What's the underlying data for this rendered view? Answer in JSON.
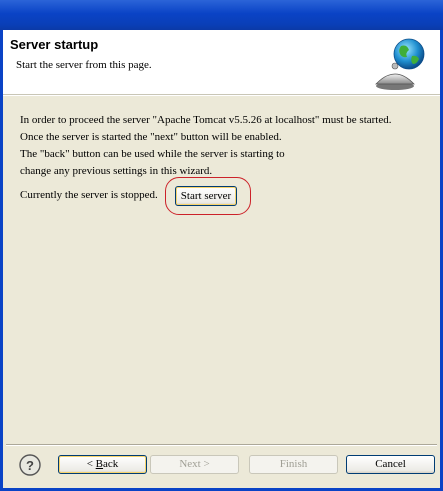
{
  "banner": {
    "title": "Server startup",
    "description": "Start the server from this page."
  },
  "message": {
    "lines": [
      "In order to proceed the server \"Apache Tomcat v5.5.26 at localhost\" must be started.",
      "Once the server is started the \"next\" button will be enabled.",
      "The \"back\" button can be used while the server is starting to",
      "change any previous settings in this wizard."
    ]
  },
  "status": {
    "text": "Currently the server is stopped.",
    "start_button_label": "Start server"
  },
  "buttons": {
    "help_symbol": "?",
    "back_prefix": "< ",
    "back_mnemonic": "B",
    "back_rest": "ack",
    "next_label": "Next >",
    "finish_label": "Finish",
    "cancel_label": "Cancel"
  },
  "icons": {
    "banner": "globe-server-icon",
    "help": "help-icon"
  }
}
